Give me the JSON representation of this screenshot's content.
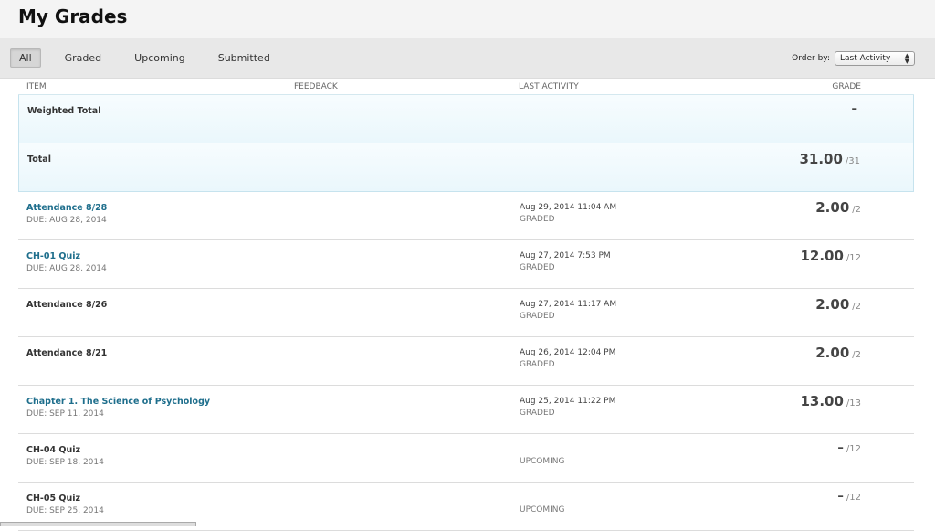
{
  "page": {
    "title": "My Grades"
  },
  "filters": {
    "tabs": [
      {
        "label": "All",
        "active": true
      },
      {
        "label": "Graded",
        "active": false
      },
      {
        "label": "Upcoming",
        "active": false
      },
      {
        "label": "Submitted",
        "active": false
      }
    ],
    "order_by_label": "Order by:",
    "order_by_value": "Last Activity"
  },
  "table": {
    "headers": {
      "item": "ITEM",
      "feedback": "FEEDBACK",
      "last_activity": "LAST ACTIVITY",
      "grade": "GRADE"
    },
    "summary_rows": [
      {
        "name": "Weighted Total",
        "score": "–",
        "possible": ""
      },
      {
        "name": "Total",
        "score": "31.00",
        "possible": "/31"
      }
    ],
    "rows": [
      {
        "name": "Attendance 8/28",
        "link": true,
        "due": "DUE: AUG 28, 2014",
        "date": "Aug 29, 2014 11:04 AM",
        "status": "GRADED",
        "score": "2.00",
        "possible": "/2"
      },
      {
        "name": "CH-01 Quiz",
        "link": true,
        "due": "DUE: AUG 28, 2014",
        "date": "Aug 27, 2014 7:53 PM",
        "status": "GRADED",
        "score": "12.00",
        "possible": "/12"
      },
      {
        "name": "Attendance 8/26",
        "link": false,
        "due": "",
        "date": "Aug 27, 2014 11:17 AM",
        "status": "GRADED",
        "score": "2.00",
        "possible": "/2"
      },
      {
        "name": "Attendance 8/21",
        "link": false,
        "due": "",
        "date": "Aug 26, 2014 12:04 PM",
        "status": "GRADED",
        "score": "2.00",
        "possible": "/2"
      },
      {
        "name": "Chapter 1. The Science of Psychology",
        "link": true,
        "due": "DUE: SEP 11, 2014",
        "date": "Aug 25, 2014 11:22 PM",
        "status": "GRADED",
        "score": "13.00",
        "possible": "/13"
      },
      {
        "name": "CH-04 Quiz",
        "link": false,
        "due": "DUE: SEP 18, 2014",
        "date": "",
        "status": "UPCOMING",
        "score": "–",
        "possible": "/12"
      },
      {
        "name": "CH-05 Quiz",
        "link": false,
        "due": "DUE: SEP 25, 2014",
        "date": "",
        "status": "UPCOMING",
        "score": "–",
        "possible": "/12"
      }
    ]
  }
}
